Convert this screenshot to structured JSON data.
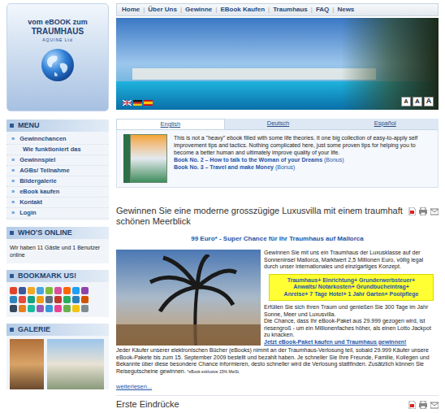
{
  "logo": {
    "line1": "vom eBOOK zum",
    "line2": "TRAUMHAUS",
    "line3": "AQUINE Ltd"
  },
  "nav": [
    {
      "label": "Home"
    },
    {
      "label": "Über Uns"
    },
    {
      "label": "Gewinne"
    },
    {
      "label": "EBook Kaufen"
    },
    {
      "label": "Traumhaus"
    },
    {
      "label": "FAQ"
    },
    {
      "label": "News"
    }
  ],
  "nav_separator": "|",
  "font_buttons": [
    "A",
    "A",
    "A"
  ],
  "sidebar": {
    "menu": {
      "title": "MENU",
      "bullet": "»",
      "items": [
        {
          "label": "Gewinnchancen",
          "kind": "link"
        },
        {
          "label": "Wie funktioniert das",
          "kind": "sub"
        },
        {
          "label": "Gewinnspiel",
          "kind": "link"
        },
        {
          "label": "AGBs/ Teilnahme",
          "kind": "link"
        },
        {
          "label": "Bildergalerie",
          "kind": "link"
        },
        {
          "label": "eBook kaufen",
          "kind": "link"
        },
        {
          "label": "Kontakt",
          "kind": "link"
        },
        {
          "label": "Login",
          "kind": "link"
        }
      ]
    },
    "who_online": {
      "title": "WHO'S ONLINE",
      "text": "Wir haben 11 Gäste und 1 Benutzer online"
    },
    "bookmark": {
      "title": "BOOKMARK US!"
    },
    "gallery": {
      "title": "GALERIE"
    }
  },
  "lang_tabs": [
    {
      "label": "English",
      "selected": true
    },
    {
      "label": "Deutsch",
      "selected": false
    },
    {
      "label": "Español",
      "selected": false
    }
  ],
  "promo": {
    "text": "This is not a \"heavy\" ebook filled with some life theories. It one big collection of easy-to-apply self improvement tips and tactics. Nothing complicated here, just some proven tips for helping you to become a better human and ultimately improve quality of your life.",
    "books": [
      {
        "title": "Book No. 2 – How to talk to the Woman of your Dreams",
        "note": "(Bonus)"
      },
      {
        "title": "Book No. 3 – Travel and make Money",
        "note": "(Bonus)"
      }
    ]
  },
  "article": {
    "title": "Gewinnen Sie eine moderne grosszügige Luxusvilla mit einem traumhaft schönen Meerblick",
    "subtitle": "99 Euro* - Super Chance für Ihr Traumhaus auf Mallorca",
    "intro": "Gewinnen Sie mit uns ein Traumhaus der Luxusklasse auf der Sonneninsel Mallorca, Marktwert 2,5 Millionen Euro, völlig legal durch unser internationales und einzigartiges Konzept.",
    "highlight": [
      "Traumhaus+ Einrichtung+ Grunderwerbsteuer+",
      "Anwalts/ Notarkosten+ Grundbucheintrag+",
      "Anreise+ 7 Tage Hotel+ 1 Jahr Garten+ Poolpflege"
    ],
    "body": [
      "Erfüllen Sie sich Ihren Traum und genießen Sie 300 Tage im Jahr Sonne, Meer und Luxusvilla.",
      "Die Chance, dass Ihr eBook-Paket aus 29.999 gezogen wird, ist riesengroß - um ein Millionenfaches höher, als einen Lotto Jackpot zu knacken."
    ],
    "cta": "Jetzt eBook-Paket kaufen und Traumhaus gewinnen!",
    "paragraph": "Jeder Käufer unserer elektronischen Bücher (eBooks) nimmt an der Traumhaus-Verlosung teil, sobald 29.999 Käufer unsere eBook-Pakete bis zum 15. September 2009 bestellt und bezahlt haben. Je schneller Sie Ihre Freunde, Familie, Kollegen und Bekannte über diese besondere Chance informieren, desto schneller wird die Verlosung stattfinden. Zusätzlich können Sie Reisegutscheine gewinnen.",
    "footnote": "*eBook exklusive 15% MwSt.",
    "read_more": "weiterlesen..."
  },
  "next_article": {
    "title": "Erste Eindrücke"
  }
}
